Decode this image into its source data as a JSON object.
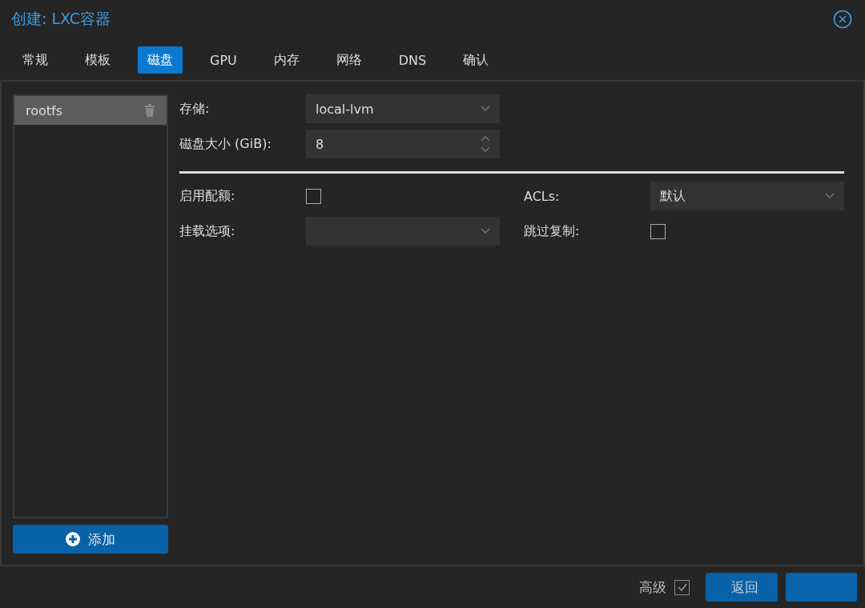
{
  "window": {
    "title": "创建: LXC容器"
  },
  "tabs": [
    {
      "label": "常规",
      "selected": false
    },
    {
      "label": "模板",
      "selected": false
    },
    {
      "label": "磁盘",
      "selected": true
    },
    {
      "label": "GPU",
      "selected": false
    },
    {
      "label": "内存",
      "selected": false
    },
    {
      "label": "网络",
      "selected": false
    },
    {
      "label": "DNS",
      "selected": false
    },
    {
      "label": "确认",
      "selected": false
    }
  ],
  "disks": [
    {
      "label": "rootfs",
      "selected": true
    }
  ],
  "add_button": "添加",
  "top_fields": [
    {
      "label": "存储:",
      "kind": "select",
      "value": "local-lvm"
    },
    {
      "label": "磁盘大小 (GiB):",
      "kind": "spinner",
      "value": "8"
    }
  ],
  "left_fields": [
    {
      "label": "启用配额:",
      "kind": "checkbox",
      "checked": false
    },
    {
      "label": "挂载选项:",
      "kind": "select"
    }
  ],
  "right_fields": [
    {
      "label": "ACLs:",
      "kind": "select",
      "value": "默认"
    },
    {
      "label": "跳过复制:",
      "kind": "checkbox",
      "checked": false
    }
  ],
  "footer": {
    "advanced_label": "高级",
    "advanced_checked": true,
    "buttons": [
      {
        "kind": "back",
        "label": "返回"
      },
      {
        "kind": "next"
      }
    ]
  }
}
